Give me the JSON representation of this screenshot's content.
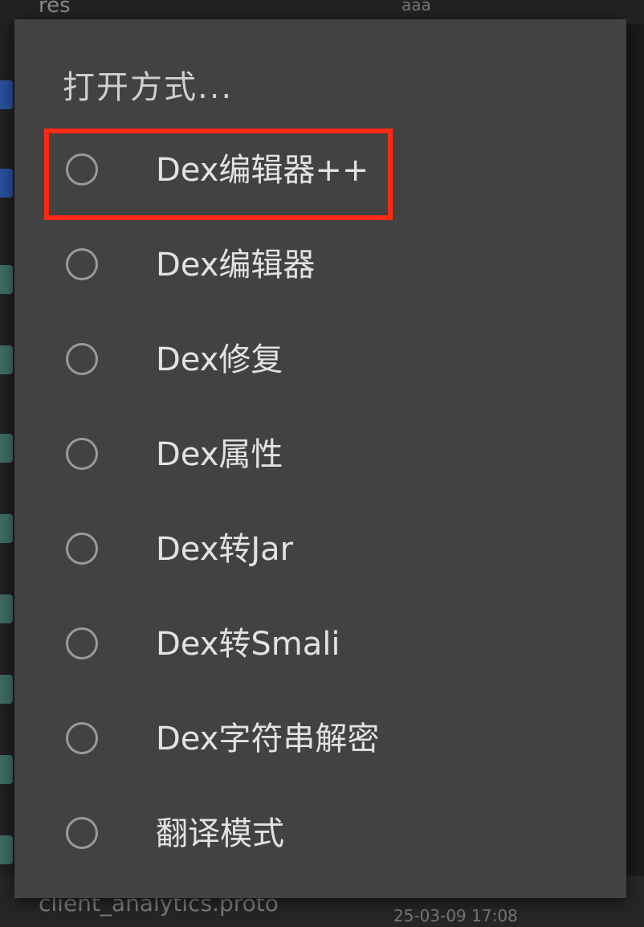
{
  "background": {
    "top_row": {
      "name": "res",
      "meta": "aaa"
    },
    "bottom_row": {
      "name": "client_analytics.proto",
      "meta": "25-03-09 17:08"
    }
  },
  "dialog": {
    "title": "打开方式...",
    "options": [
      {
        "label": "Dex编辑器++",
        "selected": false,
        "highlighted": true
      },
      {
        "label": "Dex编辑器",
        "selected": false
      },
      {
        "label": "Dex修复",
        "selected": false
      },
      {
        "label": "Dex属性",
        "selected": false
      },
      {
        "label": "Dex转Jar",
        "selected": false
      },
      {
        "label": "Dex转Smali",
        "selected": false
      },
      {
        "label": "Dex字符串解密",
        "selected": false
      },
      {
        "label": "翻译模式",
        "selected": false
      }
    ]
  },
  "colors": {
    "dialog_bg": "#424242",
    "highlight": "#ff2a14",
    "text": "#e2e2e2",
    "radio": "#9a9a9a"
  }
}
